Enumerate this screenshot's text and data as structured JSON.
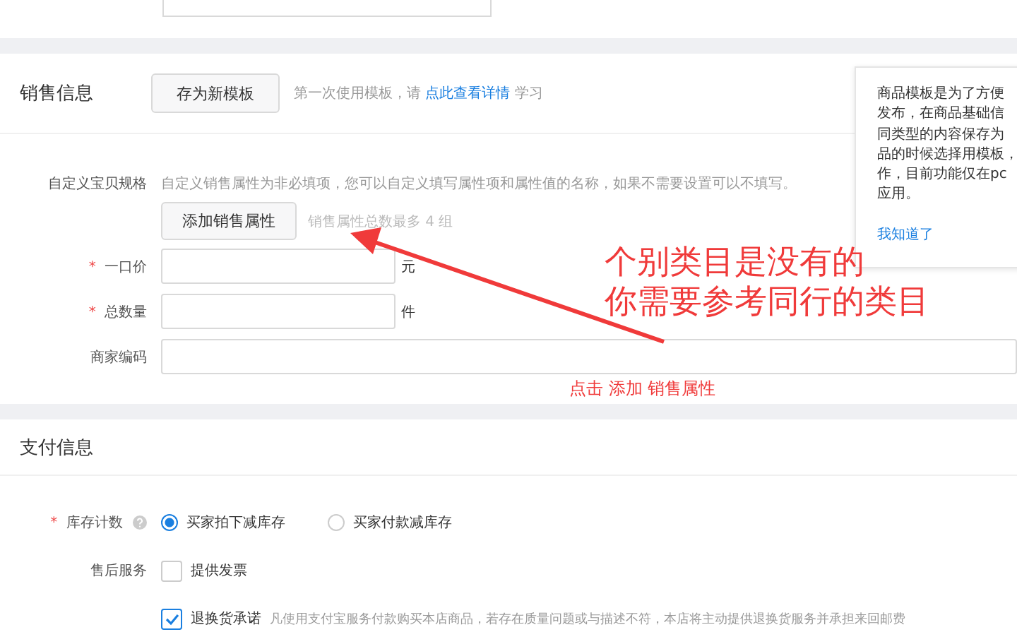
{
  "sales": {
    "title": "销售信息",
    "save_template_button": "存为新模板",
    "template_hint": {
      "before": "第一次使用模板，请",
      "link": "点此查看详情",
      "after": "学习"
    },
    "custom_spec": {
      "label": "自定义宝贝规格",
      "description": "自定义销售属性为非必填项，您可以自定义填写属性项和属性值的名称，如果不需要设置可以不填写。",
      "add_button": "添加销售属性",
      "limit_hint": "销售属性总数最多 4 组"
    },
    "fields": [
      {
        "label": "一口价",
        "required_mark": "*",
        "unit": "元",
        "wide": false
      },
      {
        "label": "总数量",
        "required_mark": "*",
        "unit": "件",
        "wide": false
      },
      {
        "label": "商家编码",
        "wide": true
      }
    ]
  },
  "popover": {
    "lines": [
      "商品模板是为了方便",
      "发布，在商品基础信",
      "同类型的内容保存为",
      "品的时候选择用模板，",
      "作，目前功能仅在pc",
      "应用。"
    ],
    "link": "我知道了"
  },
  "payment": {
    "title": "支付信息",
    "stock": {
      "label": "库存计数",
      "required_mark": "*",
      "options": [
        {
          "label": "买家拍下减库存",
          "selected": true
        },
        {
          "label": "买家付款减库存",
          "selected": false
        }
      ]
    },
    "after_sale": {
      "label": "售后服务",
      "options": [
        {
          "label": "提供发票",
          "checked": false
        },
        {
          "label": "退换货承诺",
          "checked": true,
          "note": "凡使用支付宝服务付款购买本店商品，若存在质量问题或与描述不符，本店将主动提供退换货服务并承担来回邮费"
        }
      ]
    }
  },
  "annotations": [
    {
      "kind": "big",
      "lines": [
        "个别类目是没有的",
        "你需要参考同行的类目"
      ]
    },
    {
      "kind": "small",
      "lines": [
        "点击 添加 销售属性"
      ]
    }
  ]
}
